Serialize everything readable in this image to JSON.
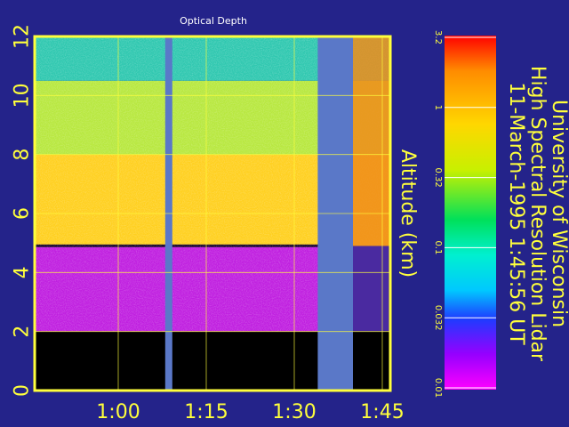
{
  "chart_data": {
    "type": "heatmap",
    "title": "Optical Depth",
    "ylabel": "Altitude (km)",
    "x_ticks": [
      "1:00",
      "1:15",
      "1:30",
      "1:45"
    ],
    "y_ticks": [
      "0",
      "2",
      "4",
      "6",
      "8",
      "10",
      "12"
    ],
    "ylim": [
      0,
      12
    ],
    "grid": true,
    "colorbar": {
      "scale": "log",
      "ticks": [
        "3.2",
        "1",
        "0.32",
        "0.1",
        "0.032",
        "0.01"
      ],
      "stops": [
        "#ff0000",
        "#ff8c00",
        "#ffd700",
        "#c8f000",
        "#00e05a",
        "#00f0d0",
        "#00c8ff",
        "#1e3cff",
        "#9600ff",
        "#ff00ff"
      ]
    },
    "gaps_time": [
      [
        "1:08",
        "1:09"
      ],
      [
        "1:34",
        "1:40"
      ]
    ],
    "layers": [
      {
        "from_km": 0,
        "to_km": 2,
        "value": "no data",
        "color": "#000000"
      },
      {
        "from_km": 2,
        "to_km": 4.9,
        "value": 0.02,
        "color": "#c020e0"
      },
      {
        "from_km": 4.9,
        "to_km": 8,
        "value": 1.2,
        "color": "#ffd020"
      },
      {
        "from_km": 8,
        "to_km": 10.5,
        "value": 0.6,
        "color": "#b8e840"
      },
      {
        "from_km": 10.5,
        "to_km": 12,
        "value": 0.2,
        "color": "#30c8b0"
      }
    ]
  },
  "header": {
    "line1": "University of Wisconsin",
    "line2": "High Spectral Resolution Lidar",
    "line3": "11-March-1995   1:45:56 UT"
  },
  "colors": {
    "background": "#24238a",
    "text": "#ffff3c",
    "frame": "#ffff3c",
    "gap": "#5a78c8"
  }
}
